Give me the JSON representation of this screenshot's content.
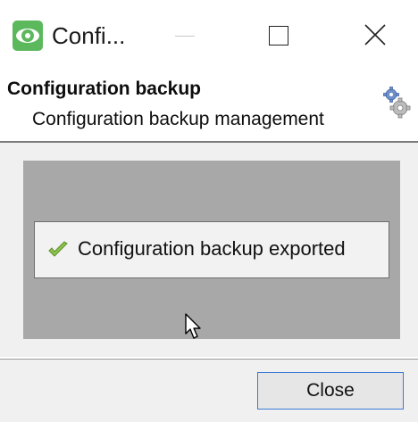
{
  "window": {
    "title": "Confi...",
    "icon": "eye-app-icon",
    "controls": [
      "minimize-icon",
      "maximize-icon",
      "close-icon"
    ]
  },
  "header": {
    "title": "Configuration backup",
    "subtitle": "Configuration backup management",
    "icon": "gears-icon"
  },
  "content": {
    "notification": {
      "icon": "check-icon",
      "text": "Configuration backup exported"
    }
  },
  "footer": {
    "close_label": "Close"
  },
  "colors": {
    "app_icon": "#5cb85c",
    "panel_gray": "#a8a8a8",
    "button_focus_border": "#3a7bd5",
    "check_green": "#8bc34a"
  }
}
